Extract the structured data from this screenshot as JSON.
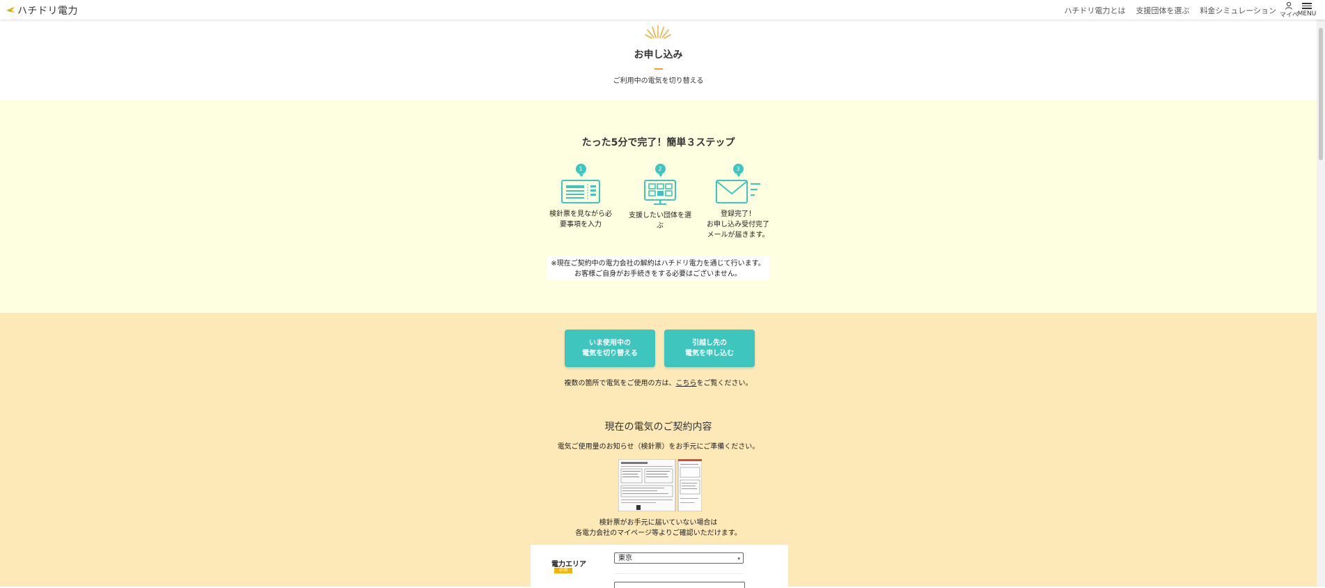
{
  "header": {
    "logo_text": "ハチドリ電力",
    "nav": [
      "ハチドリ電力とは",
      "支援団体を選ぶ",
      "料金シミュレーション"
    ],
    "user_label": "マイページ",
    "menu_label": "MENU"
  },
  "hero": {
    "title": "お申し込み",
    "subtitle": "ご利用中の電気を切り替える"
  },
  "steps": {
    "title": "たった5分で完了！簡単３ステップ",
    "items": [
      {
        "number": "1",
        "label": "検針票を見ながら必要事項を入力",
        "icon": "meter-slip-icon"
      },
      {
        "number": "2",
        "label": "支援したい団体を選ぶ",
        "icon": "monitor-icon"
      },
      {
        "number": "3",
        "label_lines": [
          "登録完了！",
          "お申し込み受付完了",
          "メールが届きます。"
        ],
        "icon": "mail-icon"
      }
    ],
    "notice_lines": [
      "※現在ご契約中の電力会社の解約はハチドリ電力を通じて行います。",
      "お客様ご自身がお手続きをする必要はございません。"
    ]
  },
  "actions": {
    "switch_line1": "いま使用中の",
    "switch_line2": "電気を切り替える",
    "move_line1": "引越し先の",
    "move_line2": "電気を申し込む",
    "multi_before": "複数の箇所で電気をご使用の方は、",
    "multi_link": "こちら",
    "multi_after": "をご覧ください。"
  },
  "contract": {
    "title": "現在の電気のご契約内容",
    "subtitle": "電気ご使用量のお知らせ（検針票）をお手元にご準備ください。",
    "note_lines": [
      "検針票がお手元に届いていない場合は",
      "各電力会社のマイページ等よりご確認いただけます。"
    ]
  },
  "form": {
    "area_label": "電力エリア",
    "required_badge": "必須",
    "area_value": "東京"
  },
  "colors": {
    "accent": "#3ec5bd",
    "cream": "#fefee0",
    "peach": "#fde8b8",
    "badge": "#f5b400"
  }
}
